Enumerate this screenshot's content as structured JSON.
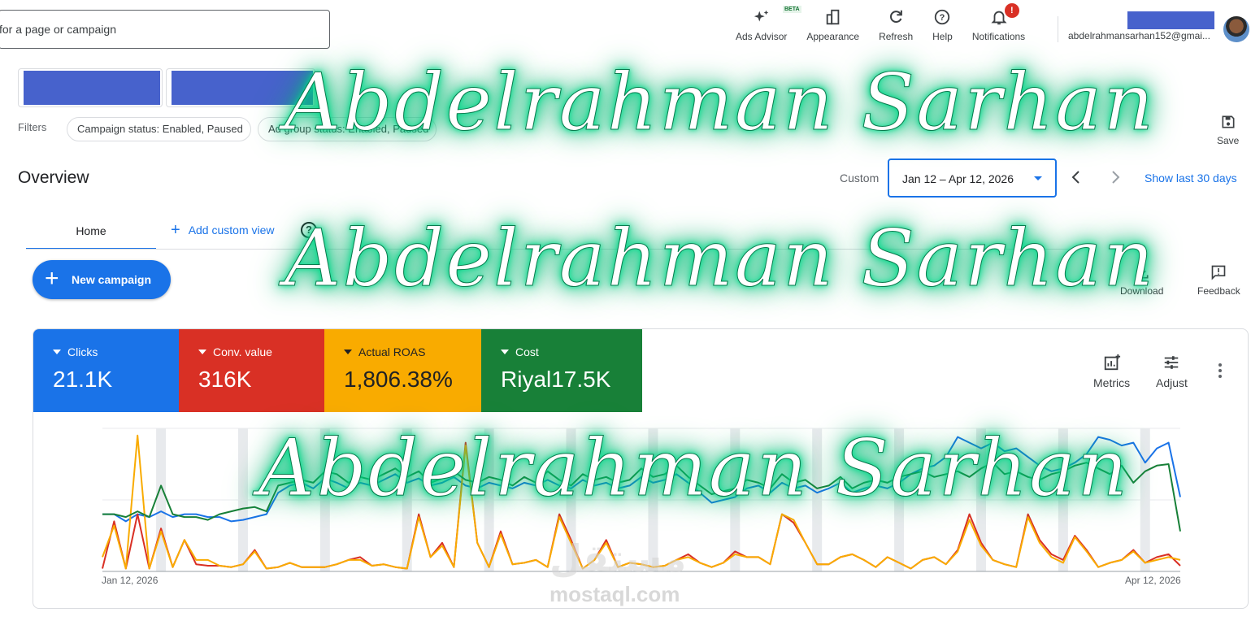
{
  "search": {
    "text": "for a page or campaign"
  },
  "toolbar": {
    "ads_advisor": "Ads Advisor",
    "beta": "BETA",
    "appearance": "Appearance",
    "refresh": "Refresh",
    "help": "Help",
    "notifications": "Notifications",
    "notification_badge": "!"
  },
  "account": {
    "email": "abdelrahmansarhan152@gmai..."
  },
  "filters": {
    "label": "Filters",
    "chips": [
      "Campaign status: Enabled, Paused",
      "Ad group status: Enabled, Paused"
    ]
  },
  "save_label": "Save",
  "overview": {
    "title": "Overview",
    "custom_label": "Custom",
    "date_range": "Jan 12 – Apr 12, 2026",
    "show_last": "Show last 30 days"
  },
  "tabs": {
    "home": "Home",
    "add_custom_view": "Add custom view"
  },
  "new_campaign": "New campaign",
  "side_tools": {
    "download": "Download",
    "feedback": "Feedback"
  },
  "metrics": [
    {
      "label": "Clicks",
      "value": "21.1K",
      "color": "#1a73e8"
    },
    {
      "label": "Conv. value",
      "value": "316K",
      "color": "#d93025"
    },
    {
      "label": "Actual ROAS",
      "value": "1,806.38%",
      "color": "#f9ab00"
    },
    {
      "label": "Cost",
      "value": "Riyal17.5K",
      "color": "#188038"
    }
  ],
  "card_tools": {
    "metrics": "Metrics",
    "adjust": "Adjust"
  },
  "chart_data": {
    "type": "line",
    "x_start_label": "Jan 12, 2026",
    "x_end_label": "Apr 12, 2026",
    "grid": true,
    "series": [
      {
        "name": "Clicks",
        "color": "#1a73e8",
        "values": [
          40,
          40,
          35,
          40,
          38,
          42,
          38,
          40,
          40,
          38,
          38,
          35,
          36,
          38,
          40,
          55,
          60,
          62,
          58,
          65,
          62,
          58,
          62,
          60,
          64,
          68,
          62,
          65,
          60,
          62,
          66,
          60,
          58,
          62,
          60,
          58,
          62,
          60,
          64,
          60,
          58,
          64,
          60,
          62,
          58,
          60,
          66,
          62,
          64,
          68,
          62,
          55,
          48,
          50,
          52,
          58,
          60,
          55,
          62,
          58,
          60,
          55,
          58,
          62,
          55,
          58,
          60,
          58,
          62,
          68,
          72,
          74,
          80,
          94,
          90,
          86,
          90,
          84,
          86,
          80,
          74,
          70,
          72,
          76,
          82,
          94,
          92,
          88,
          90,
          76,
          86,
          90,
          52
        ]
      },
      {
        "name": "Conv. value",
        "color": "#d93025",
        "values": [
          2,
          35,
          2,
          40,
          2,
          30,
          3,
          22,
          5,
          4,
          4,
          3,
          5,
          15,
          2,
          3,
          6,
          3,
          3,
          3,
          5,
          8,
          10,
          4,
          5,
          3,
          2,
          40,
          10,
          20,
          3,
          90,
          20,
          3,
          28,
          5,
          6,
          8,
          3,
          40,
          22,
          2,
          8,
          22,
          3,
          6,
          5,
          3,
          4,
          8,
          12,
          6,
          3,
          6,
          14,
          10,
          10,
          5,
          40,
          34,
          20,
          5,
          5,
          10,
          12,
          8,
          3,
          10,
          6,
          2,
          8,
          10,
          5,
          15,
          40,
          20,
          8,
          5,
          3,
          40,
          22,
          12,
          8,
          25,
          15,
          3,
          6,
          8,
          15,
          6,
          10,
          12,
          4
        ]
      },
      {
        "name": "Actual ROAS",
        "color": "#f9ab00",
        "values": [
          10,
          32,
          2,
          95,
          2,
          28,
          3,
          22,
          8,
          8,
          4,
          3,
          5,
          14,
          2,
          3,
          6,
          3,
          3,
          3,
          5,
          8,
          8,
          4,
          5,
          3,
          2,
          38,
          10,
          18,
          3,
          88,
          20,
          3,
          26,
          5,
          6,
          8,
          3,
          38,
          20,
          2,
          8,
          20,
          3,
          6,
          5,
          3,
          4,
          8,
          10,
          6,
          3,
          6,
          12,
          10,
          10,
          5,
          40,
          36,
          20,
          5,
          5,
          10,
          12,
          8,
          3,
          10,
          6,
          2,
          8,
          10,
          5,
          14,
          36,
          18,
          8,
          5,
          3,
          38,
          20,
          10,
          6,
          24,
          14,
          3,
          6,
          8,
          14,
          6,
          8,
          10,
          8
        ]
      },
      {
        "name": "Cost",
        "color": "#188038",
        "values": [
          40,
          40,
          38,
          42,
          38,
          60,
          40,
          38,
          38,
          36,
          40,
          42,
          44,
          45,
          42,
          60,
          62,
          64,
          62,
          70,
          68,
          62,
          66,
          64,
          68,
          72,
          66,
          70,
          62,
          65,
          70,
          64,
          62,
          66,
          64,
          60,
          66,
          62,
          70,
          64,
          60,
          68,
          64,
          66,
          62,
          64,
          72,
          66,
          68,
          74,
          66,
          60,
          54,
          56,
          58,
          64,
          62,
          58,
          68,
          62,
          64,
          58,
          60,
          66,
          58,
          62,
          64,
          62,
          66,
          68,
          70,
          66,
          68,
          70,
          66,
          72,
          76,
          68,
          70,
          66,
          64,
          68,
          70,
          74,
          76,
          72,
          68,
          74,
          62,
          70,
          74,
          75,
          28
        ]
      }
    ]
  }
}
